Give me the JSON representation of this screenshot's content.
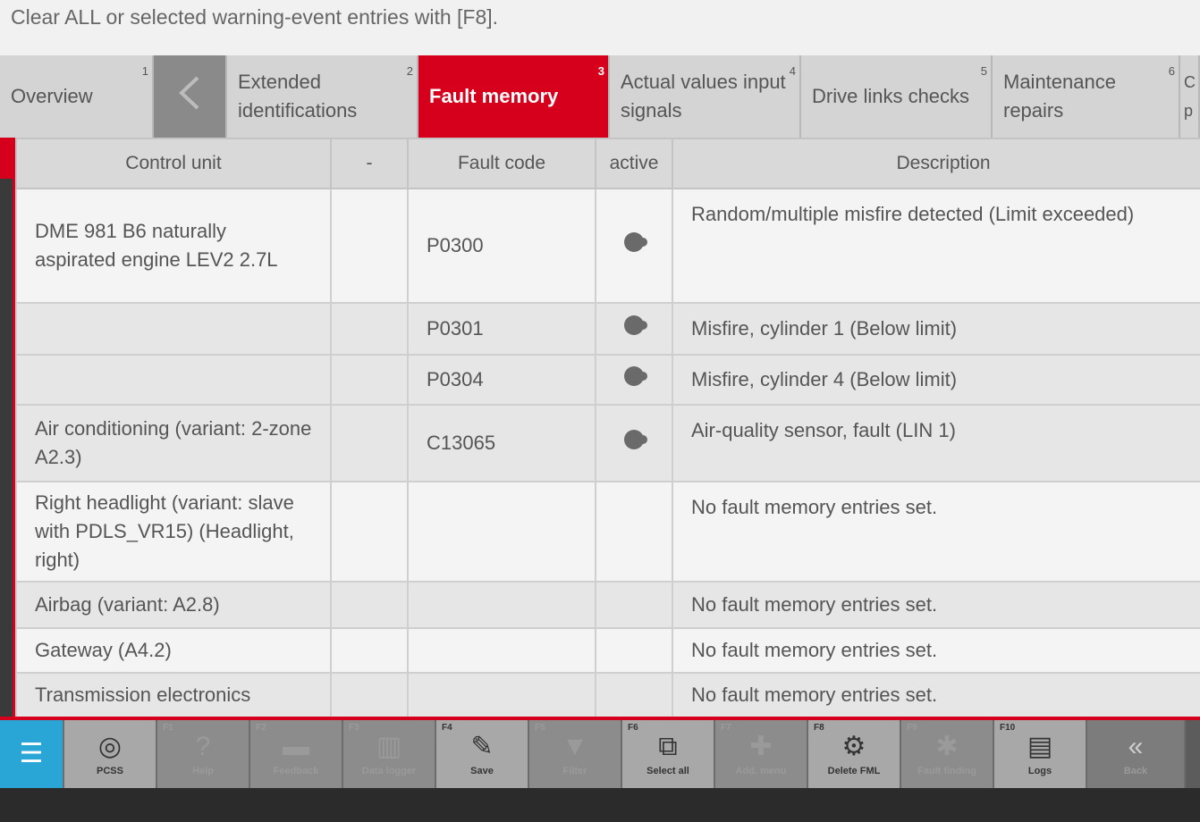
{
  "hint_text": "Clear ALL or selected warning-event entries with [F8].",
  "tabs": [
    {
      "label": "Overview",
      "num": "1"
    },
    {
      "label": "",
      "num": ""
    },
    {
      "label": "Extended identifications",
      "num": "2"
    },
    {
      "label": "Fault memory",
      "num": "3"
    },
    {
      "label": "Actual values input signals",
      "num": "4"
    },
    {
      "label": "Drive links checks",
      "num": "5"
    },
    {
      "label": "Maintenance repairs",
      "num": "6"
    },
    {
      "label": "C p",
      "num": ""
    }
  ],
  "columns": {
    "control_unit": "Control unit",
    "dash": "-",
    "fault_code": "Fault code",
    "active": "active",
    "description": "Description"
  },
  "rows": [
    {
      "unit": "DME 981 B6 naturally aspirated engine LEV2 2.7L",
      "dash": "",
      "code": "P0300",
      "desc": "Random/multiple misfire detected (Limit exceeded)"
    },
    {
      "unit": "",
      "dash": "",
      "code": "P0301",
      "desc": "Misfire, cylinder 1 (Below limit)"
    },
    {
      "unit": "",
      "dash": "",
      "code": "P0304",
      "desc": "Misfire, cylinder 4 (Below limit)"
    },
    {
      "unit": "Air conditioning (variant: 2-zone A2.3)",
      "dash": "",
      "code": "C13065",
      "desc": "Air-quality sensor, fault (LIN 1)"
    },
    {
      "unit": "Right headlight (variant: slave with PDLS_VR15) (Headlight, right)",
      "dash": "",
      "code": "",
      "desc": "No fault memory entries set."
    },
    {
      "unit": "Airbag (variant: A2.8)",
      "dash": "",
      "code": "",
      "desc": "No fault memory entries set."
    },
    {
      "unit": "Gateway (A4.2)",
      "dash": "",
      "code": "",
      "desc": "No fault memory entries set."
    },
    {
      "unit": "Transmission electronics",
      "dash": "",
      "code": "",
      "desc": "No fault memory entries set."
    }
  ],
  "toolbar": [
    {
      "fkey": "",
      "label": "",
      "icon": "menu-icon"
    },
    {
      "fkey": "",
      "label": "PCSS",
      "icon": "pcss-icon"
    },
    {
      "fkey": "F1",
      "label": "Help",
      "icon": "help-icon"
    },
    {
      "fkey": "F2",
      "label": "Feedback",
      "icon": "feedback-icon"
    },
    {
      "fkey": "F3",
      "label": "Data logger",
      "icon": "data-logger-icon"
    },
    {
      "fkey": "F4",
      "label": "Save",
      "icon": "save-icon"
    },
    {
      "fkey": "F5",
      "label": "Filter",
      "icon": "filter-icon"
    },
    {
      "fkey": "F6",
      "label": "Select all",
      "icon": "select-all-icon"
    },
    {
      "fkey": "F7",
      "label": "Add. menu",
      "icon": "add-menu-icon"
    },
    {
      "fkey": "F8",
      "label": "Delete FML",
      "icon": "delete-fml-icon"
    },
    {
      "fkey": "F9",
      "label": "Fault finding",
      "icon": "fault-finding-icon"
    },
    {
      "fkey": "F10",
      "label": "Logs",
      "icon": "logs-icon"
    },
    {
      "fkey": "",
      "label": "Back",
      "icon": "collapse-icon"
    }
  ]
}
